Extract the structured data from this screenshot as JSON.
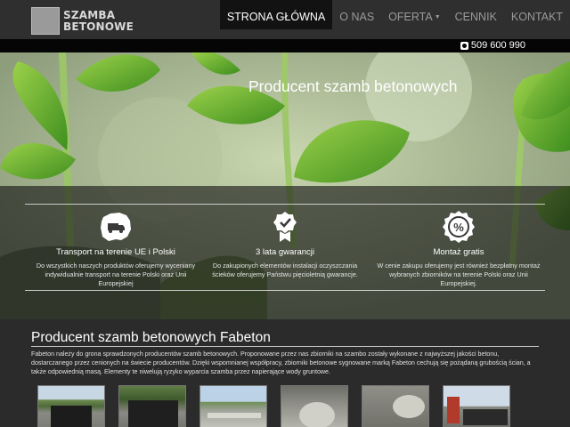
{
  "header": {
    "logo_line1": "SZAMBA",
    "logo_line2": "BETONOWE",
    "nav": [
      {
        "label": "STRONA GŁÓWNA"
      },
      {
        "label": "O NAS"
      },
      {
        "label": "OFERTA"
      },
      {
        "label": "CENNIK"
      },
      {
        "label": "KONTAKT"
      }
    ]
  },
  "phone": {
    "number": "509 600 990",
    "icon": "phone-icon"
  },
  "hero": {
    "title": "Producent szamb betonowych",
    "features": [
      {
        "icon": "poland-truck-icon",
        "title": "Transport na terenie UE i Polski",
        "text": "Do wszystkich naszych produktów oferujemy wyceniany indywidualnie transport na terenie Polski oraz Unii Europejskiej"
      },
      {
        "icon": "guarantee-badge-icon",
        "title": "3 lata gwarancji",
        "text": "Do zakupionych elementów instalacji oczyszczania ścieków oferujemy Państwu pięcioletnią gwarancje."
      },
      {
        "icon": "percent-badge-icon",
        "title": "Montaż gratis",
        "text": "W cenie zakupu oferujemy jest również bezpłatny montaż wybranych zbiorników na terenie Polski oraz Unii Europejskiej."
      }
    ]
  },
  "content": {
    "title": "Producent szamb betonowych Fabeton",
    "text": "Fabeton należy do grona sprawdzonych producentów szamb betonowych. Proponowane przez nas zbiorniki na szambo zostały wykonane z najwyższej jakości betonu, dostarczanego przez cenionych na świecie producentów. Dzięki wspomnianej współpracy, zbiorniki betonowe sygnowane marką Fabeton cechują się pożądaną grubością ścian, a także odpowiednią masą. Elementy te niwelują ryzyko wyparcia szamba przez napierające wody gruntowe."
  },
  "colors": {
    "header_bg": "#2f2f2f",
    "nav_active_bg": "#121212",
    "page_bg": "#2b2b2b"
  }
}
